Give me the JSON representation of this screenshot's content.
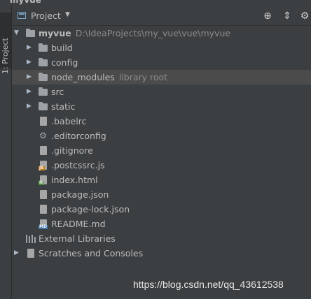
{
  "window_title": "myvue",
  "side_tab": "1: Project",
  "header": {
    "title": "Project"
  },
  "tree": {
    "root": {
      "name": "myvue",
      "path": "D:\\IdeaProjects\\my_vue\\vue\\myvue"
    },
    "folders": [
      {
        "name": "build"
      },
      {
        "name": "config"
      },
      {
        "name": "node_modules",
        "hint": "library root"
      },
      {
        "name": "src"
      },
      {
        "name": "static"
      }
    ],
    "files": [
      {
        "name": ".babelrc",
        "icon": "config-file-icon"
      },
      {
        "name": ".editorconfig",
        "icon": "gear-icon"
      },
      {
        "name": ".gitignore",
        "icon": "config-file-icon"
      },
      {
        "name": ".postcssrc.js",
        "icon": "js-file-icon",
        "badge": "JS"
      },
      {
        "name": "index.html",
        "icon": "html-file-icon",
        "badge": "H"
      },
      {
        "name": "package.json",
        "icon": "json-file-icon"
      },
      {
        "name": "package-lock.json",
        "icon": "json-file-icon"
      },
      {
        "name": "README.md",
        "icon": "markdown-file-icon",
        "badge": "MD"
      }
    ],
    "external_libraries": "External Libraries",
    "scratches": "Scratches and Consoles"
  },
  "watermark": "https://blog.csdn.net/qq_43612538",
  "colors": {
    "background": "#3c3f41",
    "selected_row": "#4b4b4b",
    "text": "#bbbbbb",
    "hint": "#8c8c8c"
  }
}
